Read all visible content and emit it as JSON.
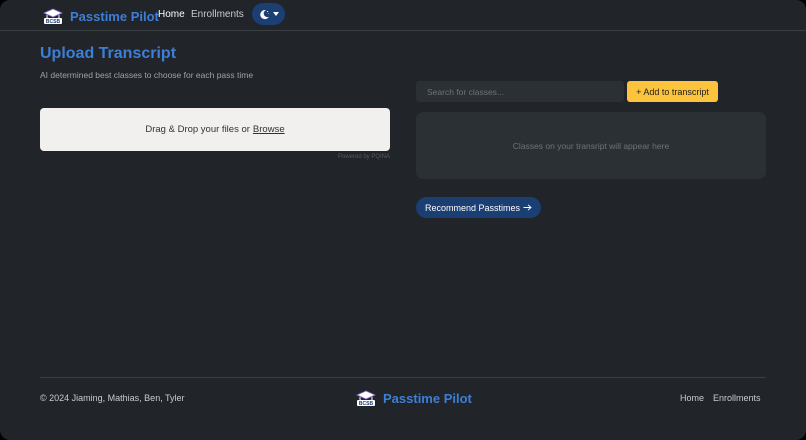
{
  "navbar": {
    "brand_text": "Passtime Pilot",
    "logo_text": "BCSB",
    "links": [
      {
        "label": "Home",
        "active": true
      },
      {
        "label": "Enrollments",
        "active": false
      }
    ],
    "theme_icon": "moon-icon"
  },
  "main": {
    "title": "Upload Transcript",
    "subtitle": "AI determined best classes to choose for each pass time",
    "dropzone": {
      "text": "Drag & Drop your files or",
      "browse_label": "Browse",
      "powered_by": "Powered by PQINA"
    },
    "search": {
      "placeholder": "Search for classes...",
      "value": ""
    },
    "add_button_label": "+ Add to transcript",
    "transcript_empty_text": "Classes on your transript will appear here",
    "recommend_button_label": "Recommend Passtimes"
  },
  "footer": {
    "copyright": "© 2024 Jiaming, Mathias, Ben, Tyler",
    "brand_text": "Passtime Pilot",
    "links": [
      "Home",
      "Enrollments"
    ]
  },
  "colors": {
    "background": "#212529",
    "accent": "#3d7ed6",
    "warning": "#fcc43d",
    "primary_dark": "#1b3e73"
  }
}
